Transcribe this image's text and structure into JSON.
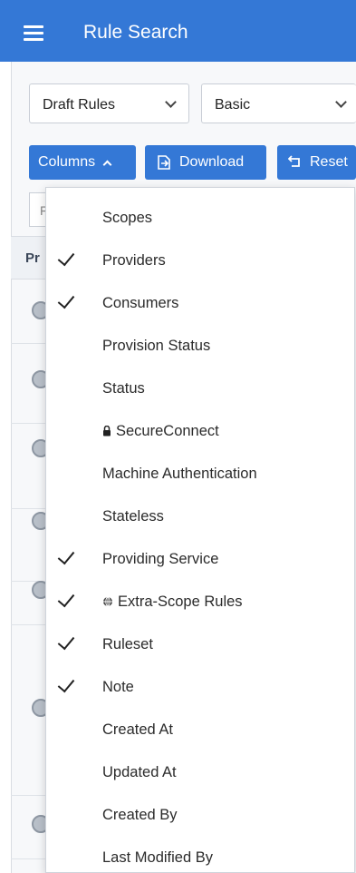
{
  "header": {
    "title": "Rule Search"
  },
  "filters": {
    "rule_type": "Draft Rules",
    "search_mode": "Basic"
  },
  "toolbar": {
    "columns_label": "Columns",
    "download_label": "Download",
    "reset_label": "Reset"
  },
  "search": {
    "placeholder": "F"
  },
  "table": {
    "first_column_header": "Pr"
  },
  "columns_menu": {
    "items": [
      {
        "label": "Scopes",
        "checked": false
      },
      {
        "label": "Providers",
        "checked": true
      },
      {
        "label": "Consumers",
        "checked": true
      },
      {
        "label": "Provision Status",
        "checked": false
      },
      {
        "label": "Status",
        "checked": false
      },
      {
        "label": "SecureConnect",
        "checked": false,
        "icon": "lock-icon"
      },
      {
        "label": "Machine Authentication",
        "checked": false
      },
      {
        "label": "Stateless",
        "checked": false
      },
      {
        "label": "Providing Service",
        "checked": true
      },
      {
        "label": "Extra-Scope Rules",
        "checked": true,
        "icon": "globe-icon"
      },
      {
        "label": "Ruleset",
        "checked": true
      },
      {
        "label": "Note",
        "checked": true
      },
      {
        "label": "Created At",
        "checked": false
      },
      {
        "label": "Updated At",
        "checked": false
      },
      {
        "label": "Created By",
        "checked": false
      },
      {
        "label": "Last Modified By",
        "checked": false
      }
    ]
  },
  "colors": {
    "primary": "#3478d6",
    "header_text": "#ffffff"
  }
}
